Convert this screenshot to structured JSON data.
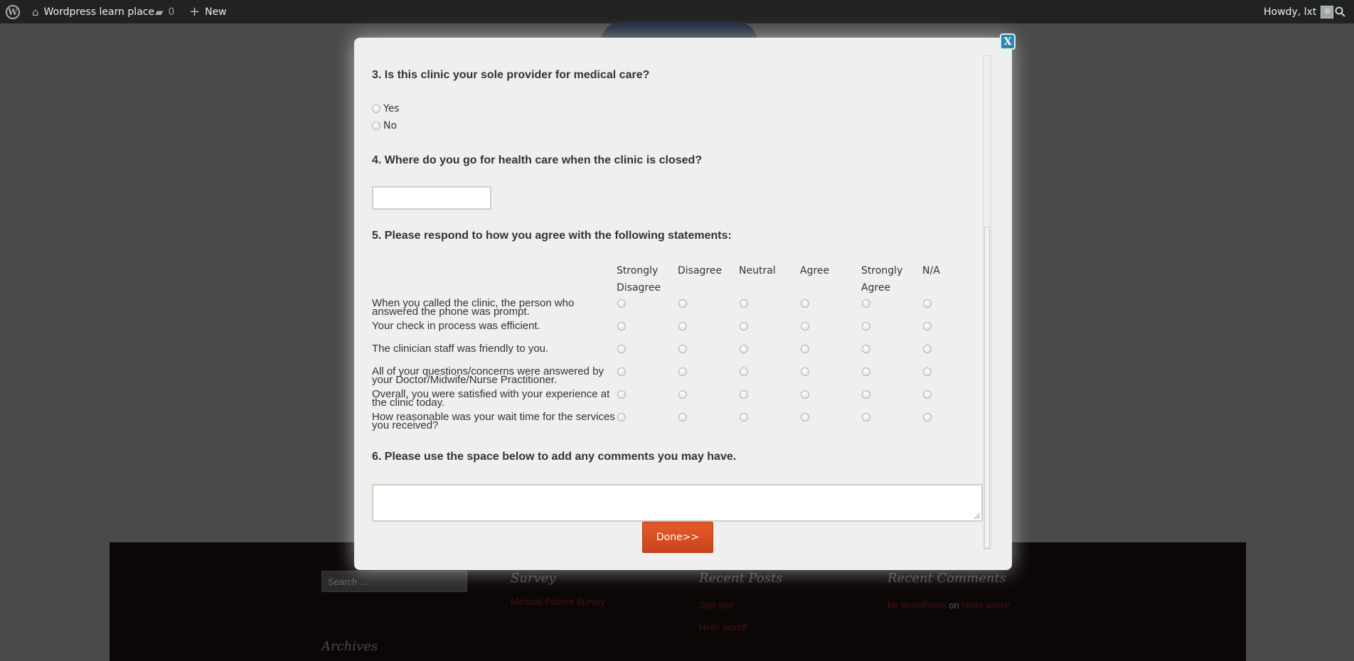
{
  "adminbar": {
    "logo": "W",
    "site_name": "Wordpress learn place",
    "comments_count": "0",
    "new_label": "New",
    "howdy": "Howdy, lxt",
    "icons": {
      "home": "home-icon",
      "comments": "comment-bubble-icon",
      "new": "plus-icon",
      "search": "search-icon"
    }
  },
  "footer": {
    "search_placeholder": "Search …",
    "survey_title": "Survey",
    "survey_link": "Medical Patient Survey",
    "recent_posts_title": "Recent Posts",
    "recent_posts": [
      "Jast test",
      "Hello world!"
    ],
    "recent_comments_title": "Recent Comments",
    "comment_author": "Mr WordPress",
    "comment_on": "on",
    "comment_post": "Hello world!",
    "archives_title": "Archives"
  },
  "modal": {
    "close_label": "X",
    "q3": {
      "title": "3. Is this clinic your sole provider for medical care?",
      "options": [
        "Yes",
        "No"
      ]
    },
    "q4": {
      "title": "4. Where do you go for health care when the clinic is closed?",
      "value": ""
    },
    "q5": {
      "title": "5. Please respond to how you agree with the following statements:",
      "columns": [
        "Strongly Disagree",
        "Disagree",
        "Neutral",
        "Agree",
        "Strongly Agree",
        "N/A"
      ],
      "rows": [
        "When you called the clinic, the person who answered the phone was prompt.",
        "Your check in process was efficient.",
        "The clinician staff was friendly to you.",
        "All of your questions/concerns were answered by your Doctor/Midwife/Nurse Practitioner.",
        "Overall, you were satisfied with your experience at the clinic today.",
        "How reasonable was your wait time for the services you received?"
      ]
    },
    "q6": {
      "title": "6. Please use the space below to add any comments you may have.",
      "value": ""
    },
    "done_label": "Done>>"
  }
}
